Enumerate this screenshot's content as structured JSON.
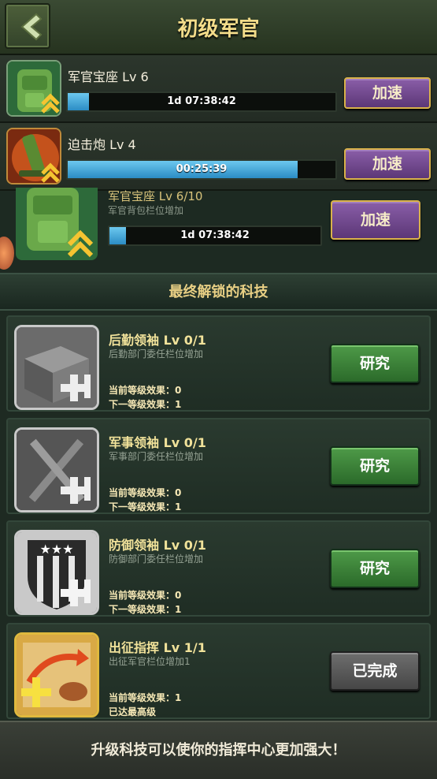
{
  "header": {
    "title": "初级军官",
    "back_icon": "chevron-left-icon"
  },
  "queue": [
    {
      "label": "军官宝座 Lv 6",
      "time": "1d 07:38:42",
      "progress": 0.08,
      "button": "加速",
      "icon": "backpack-icon"
    },
    {
      "label": "迫击炮 Lv 4",
      "time": "00:25:39",
      "progress": 0.86,
      "button": "加速",
      "icon": "mortar-icon"
    }
  ],
  "under_item": {
    "title": "军官宝座 Lv 6/10",
    "desc": "军官背包栏位增加",
    "time": "1d 07:38:42",
    "progress": 0.08,
    "button": "加速"
  },
  "section_title": "最终解锁的科技",
  "techs": [
    {
      "title": "后勤领袖 Lv 0/1",
      "desc": "后勤部门委任栏位增加",
      "current": "当前等级效果：0",
      "next": "下一等级效果：1",
      "button": "研究",
      "status": "research",
      "icon": "crate-plus-icon"
    },
    {
      "title": "军事领袖 Lv 0/1",
      "desc": "军事部门委任栏位增加",
      "current": "当前等级效果：0",
      "next": "下一等级效果：1",
      "button": "研究",
      "status": "research",
      "icon": "crossed-rifles-icon"
    },
    {
      "title": "防御领袖 Lv 0/1",
      "desc": "防御部门委任栏位增加",
      "current": "当前等级效果：0",
      "next": "下一等级效果：1",
      "button": "研究",
      "status": "research",
      "icon": "shield-stars-icon"
    },
    {
      "title": "出征指挥 Lv 1/1",
      "desc": "出征军官栏位增加1",
      "current": "当前等级效果：1",
      "next": "已达最高级",
      "button": "已完成",
      "status": "done",
      "icon": "map-plus-icon"
    }
  ],
  "footer": "升级科技可以使你的指挥中心更加强大！",
  "colors": {
    "accent_gold": "#f3dc8a",
    "progress_blue": "#2b8cc4",
    "button_purple": "#5c3777",
    "button_green": "#2b6a2a"
  }
}
